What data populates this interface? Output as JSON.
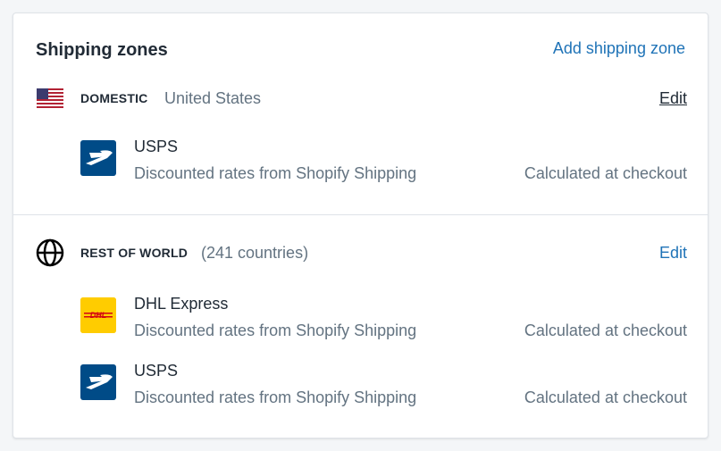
{
  "card": {
    "title": "Shipping zones",
    "add_zone_label": "Add shipping zone"
  },
  "zones": [
    {
      "name": "DOMESTIC",
      "subtitle": "United States",
      "icon": "us-flag-icon",
      "edit_label": "Edit",
      "rates": [
        {
          "carrier": "USPS",
          "logo": "usps-logo-icon",
          "description": "Discounted rates from Shopify Shipping",
          "price": "Calculated at checkout"
        }
      ]
    },
    {
      "name": "REST OF WORLD",
      "subtitle": "(241 countries)",
      "icon": "globe-icon",
      "edit_label": "Edit",
      "rates": [
        {
          "carrier": "DHL Express",
          "logo": "dhl-logo-icon",
          "logo_text": "DHL",
          "description": "Discounted rates from Shopify Shipping",
          "price": "Calculated at checkout"
        },
        {
          "carrier": "USPS",
          "logo": "usps-logo-icon",
          "description": "Discounted rates from Shopify Shipping",
          "price": "Calculated at checkout"
        }
      ]
    }
  ],
  "colors": {
    "link": "#1f73b7",
    "usps_blue": "#004b87",
    "dhl_yellow": "#ffcc00",
    "dhl_red": "#d40511"
  }
}
